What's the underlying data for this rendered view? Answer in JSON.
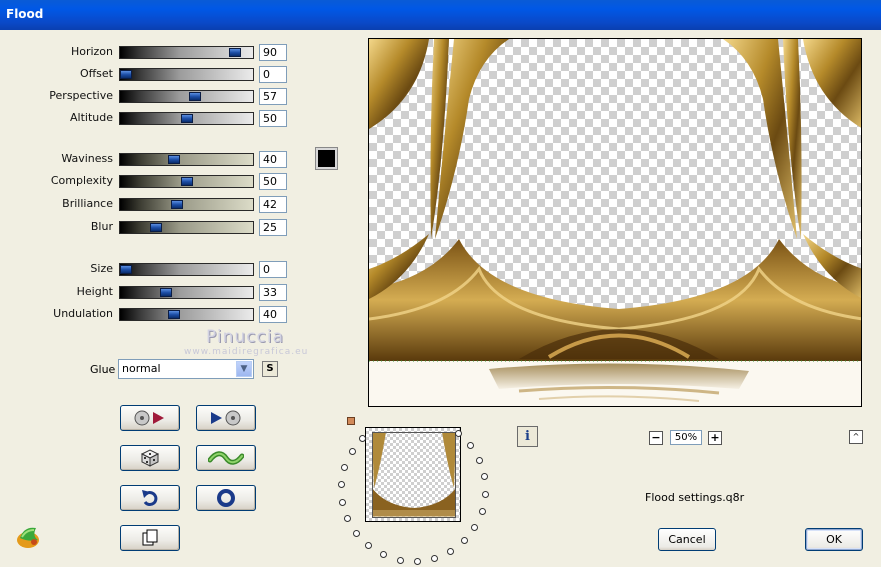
{
  "window": {
    "title": "Flood"
  },
  "sliders": [
    {
      "label": "Horizon",
      "value": "90",
      "pct": 90,
      "style": "gray"
    },
    {
      "label": "Offset",
      "value": "0",
      "pct": 0,
      "style": "gray"
    },
    {
      "label": "Perspective",
      "value": "57",
      "pct": 57,
      "style": "gray"
    },
    {
      "label": "Altitude",
      "value": "50",
      "pct": 50,
      "style": "gray"
    },
    {
      "label": "Waviness",
      "value": "40",
      "pct": 40,
      "style": "olive"
    },
    {
      "label": "Complexity",
      "value": "50",
      "pct": 50,
      "style": "olive"
    },
    {
      "label": "Brilliance",
      "value": "42",
      "pct": 42,
      "style": "olive"
    },
    {
      "label": "Blur",
      "value": "25",
      "pct": 25,
      "style": "olive"
    },
    {
      "label": "Size",
      "value": "0",
      "pct": 0,
      "style": "gray"
    },
    {
      "label": "Height",
      "value": "33",
      "pct": 33,
      "style": "gray"
    },
    {
      "label": "Undulation",
      "value": "40",
      "pct": 40,
      "style": "gray"
    }
  ],
  "color_swatch": "#000000",
  "watermark": {
    "name": "Pinuccia",
    "site": "www.maidiregrafica.eu"
  },
  "glue": {
    "label": "Glue",
    "value": "normal",
    "s_button": "S"
  },
  "toolbar": [
    {
      "name": "back-preset-button",
      "icon": "disc-play-back"
    },
    {
      "name": "forward-preset-button",
      "icon": "play-disc"
    },
    {
      "name": "randomize-button",
      "icon": "dice"
    },
    {
      "name": "wave-button",
      "icon": "wave"
    },
    {
      "name": "undo-button",
      "icon": "undo-arrow"
    },
    {
      "name": "reset-button",
      "icon": "circle"
    },
    {
      "name": "copy-button",
      "icon": "copy-pages"
    }
  ],
  "zoom": {
    "minus": "−",
    "value": "50%",
    "plus": "+"
  },
  "info_button": "i",
  "up_button": "^",
  "settings_file": "Flood settings.q8r",
  "buttons": {
    "cancel": "Cancel",
    "ok": "OK"
  }
}
